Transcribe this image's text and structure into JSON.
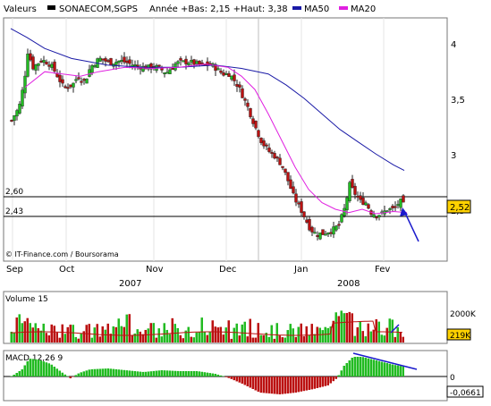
{
  "header": {
    "label": "Valeurs",
    "symbol": "SONAECOM,SGPS",
    "range_text": "Année +Bas: 2,15 +Haut: 3,38",
    "legend": [
      {
        "name": "MA50",
        "color": "#1a1aa6"
      },
      {
        "name": "MA20",
        "color": "#e020e0"
      }
    ]
  },
  "colors": {
    "up": "#22bb22",
    "down": "#bb1111",
    "ma50": "#1a1aa6",
    "ma20": "#e020e0",
    "signal": "#bb1111",
    "arrow": "#1a1acc",
    "last_box": "#ffd200"
  },
  "watermark": "© IT-Finance.com / Boursorama",
  "x_axis": {
    "months": [
      "Sep",
      "Oct",
      "Nov",
      "Dec",
      "Jan",
      "Fev"
    ],
    "years": [
      "2007",
      "2008"
    ]
  },
  "price_panel": {
    "ticks": [
      "4",
      "3,5",
      "3",
      "2,5"
    ],
    "hlines": [
      {
        "label": "2,60",
        "value": 2.6
      },
      {
        "label": "2,43",
        "value": 2.43
      }
    ],
    "last_value": "2,52"
  },
  "volume_panel": {
    "title": "Volume 15",
    "tick": "2000K",
    "last_value": "219K"
  },
  "macd_panel": {
    "title": "MACD 12,26 9",
    "tick": "0",
    "last_value": "-0,0661"
  },
  "chart_data": {
    "type": "candlestick",
    "y_range": [
      2.15,
      3.38
    ],
    "price_axis_visible_range": [
      2.05,
      4.3
    ],
    "months": [
      "Sep",
      "Oct",
      "Nov",
      "Dec",
      "Jan",
      "Fev"
    ],
    "price_path_samples": [
      {
        "month": "Sep",
        "close": 3.3
      },
      {
        "month": "Sep",
        "close": 3.9
      },
      {
        "month": "Oct",
        "close": 3.7
      },
      {
        "month": "Oct",
        "close": 3.8
      },
      {
        "month": "Nov",
        "close": 3.8
      },
      {
        "month": "Nov",
        "close": 3.8
      },
      {
        "month": "Dec",
        "close": 3.6
      },
      {
        "month": "Dec",
        "close": 3.0
      },
      {
        "month": "Jan",
        "close": 2.3
      },
      {
        "month": "Jan",
        "close": 2.35
      },
      {
        "month": "Fev",
        "close": 2.6
      },
      {
        "month": "Fev",
        "close": 2.52
      }
    ],
    "ma50_samples": [
      4.13,
      3.95,
      3.85,
      3.78,
      3.8,
      3.75,
      3.6,
      3.3,
      3.05,
      2.85
    ],
    "ma20_samples": [
      3.6,
      3.75,
      3.73,
      3.76,
      3.8,
      3.5,
      3.0,
      2.55,
      2.5,
      2.48
    ],
    "volume_peak": 2000000,
    "macd_zero": 0
  }
}
